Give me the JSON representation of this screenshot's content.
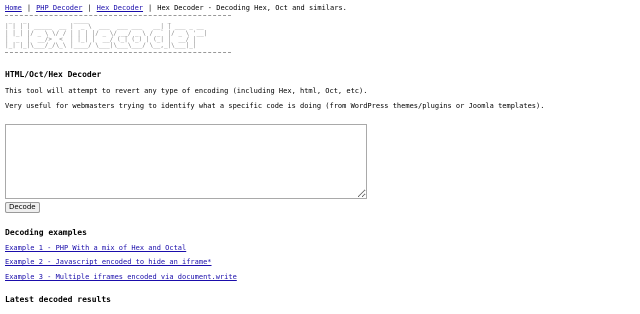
{
  "nav": {
    "home": "Home",
    "php_decoder": "PHP Decoder",
    "hex_decoder": "Hex Decoder",
    "tagline": "Hex Decoder - Decoding Hex, Oct and similars.",
    "separator": "|"
  },
  "banner": {
    "ascii": " _   _             ____                      _           \n| | | | _____  __ |  _ \\  ___  ___ ___   __| | ___ _ __ \n| |_| |/ _ \\ \\/ / | | | |/ _ \\/ __/ _ \\ / _` |/ _ \\ '__|\n|  _  |  __/>  <  | |_| |  __/ (_| (_) | (_| |  __/ |   \n|_| |_|\\___/_/\\_\\ |____/ \\___|\\___\\___/ \\__,_|\\___|_|   "
  },
  "main": {
    "heading": "HTML/Oct/Hex Decoder",
    "intro": "This tool will attempt to revert any type of encoding (including Hex, html, Oct, etc).",
    "description": "Very useful for webmasters trying to identify what a specific code is doing (from WordPress themes/plugins or Joomla templates).",
    "input_value": "",
    "decode_label": "Decode"
  },
  "examples": {
    "heading": "Decoding examples",
    "items": [
      "Example 1 - PHP With a mix of Hex and Octal",
      "Example 2 - Javascript encoded to hide an iframe*",
      "Example 3 - Multiple iframes encoded via document.write"
    ]
  },
  "latest": {
    "heading": "Latest decoded results"
  }
}
